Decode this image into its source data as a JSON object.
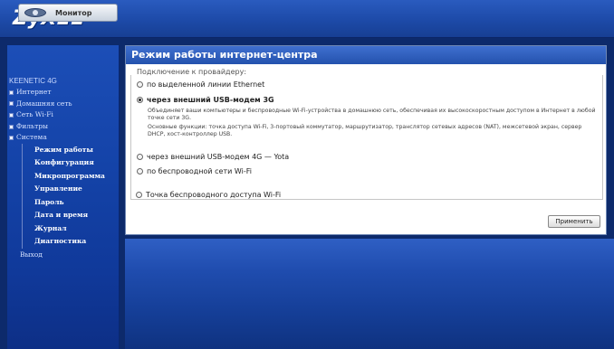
{
  "header": {
    "logo": "ZyXEL"
  },
  "sidebar": {
    "monitor_button": "Монитор",
    "device_name": "KEENETIC 4G",
    "items": [
      {
        "label": "Интернет"
      },
      {
        "label": "Домашняя сеть"
      },
      {
        "label": "Сеть Wi-Fi"
      },
      {
        "label": "Фильтры"
      },
      {
        "label": "Система"
      }
    ],
    "system_subitems": [
      "Режим работы",
      "Конфигурация",
      "Микропрограмма",
      "Управление",
      "Пароль",
      "Дата и время",
      "Журнал",
      "Диагностика"
    ],
    "exit": "Выход"
  },
  "main": {
    "title": "Режим работы интернет-центра",
    "group_legend": "Подключение к провайдеру:",
    "options": [
      {
        "label": "по выделенной линии Ethernet",
        "selected": false
      },
      {
        "label": "через внешний USB-модем 3G",
        "selected": true
      },
      {
        "label": "через внешний USB-модем 4G — Yota",
        "selected": false
      },
      {
        "label": "по беспроводной сети Wi-Fi",
        "selected": false
      }
    ],
    "description_1": "Объединяет ваши компьютеры и беспроводные Wi-Fi-устройства в домашнюю сеть, обеспечивая их высокоскоростным доступом в Интернет в любой точке сети 3G.",
    "description_2": "Основные функции: точка доступа Wi-Fi, 3-портовый коммутатор, маршрутизатор, транслятор сетевых адресов (NAT), межсетевой экран, сервер DHCP, хост-контроллер USB.",
    "access_point_option": {
      "label": "Точка беспроводного доступа Wi-Fi",
      "selected": false
    },
    "apply_button": "Применить"
  }
}
